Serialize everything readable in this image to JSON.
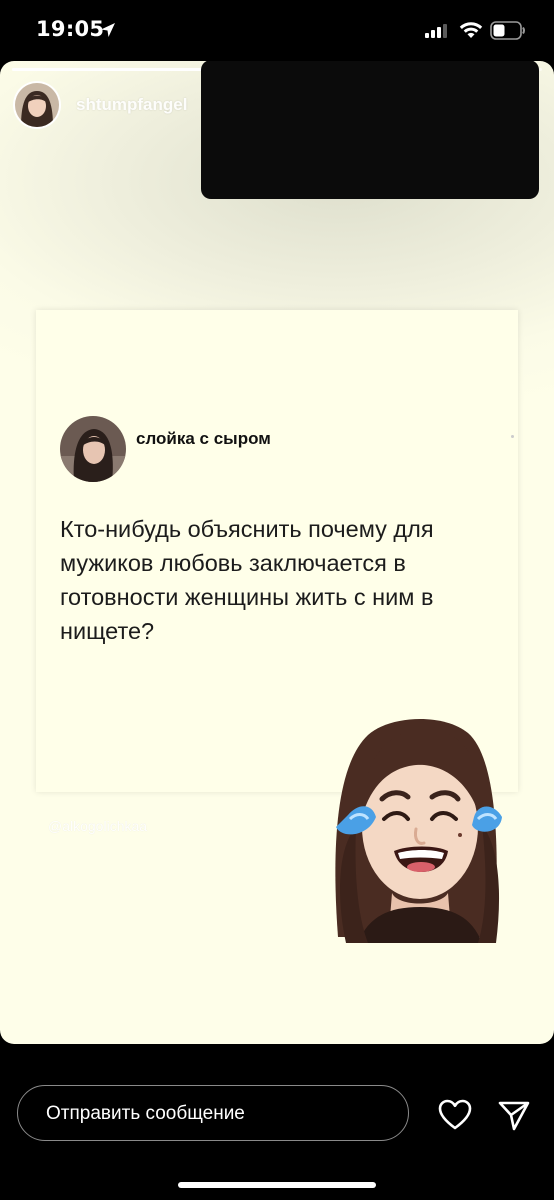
{
  "status_bar": {
    "time": "19:05",
    "icons": [
      "location-arrow-icon",
      "cellular-signal-icon",
      "wifi-icon",
      "battery-icon"
    ]
  },
  "story": {
    "author_name": "shtumpfangel",
    "progress": 0.37,
    "post": {
      "username": "слойка с сыром",
      "text": "Кто-нибудь объяснить почему для мужиков любовь заключается в готовности женщины жить с ним в нищете?"
    },
    "watermark": "@alkogolichkaa",
    "sticker": "crying-laughing-memoji"
  },
  "reply_bar": {
    "placeholder": "Отправить сообщение",
    "like_icon": "heart-icon",
    "send_icon": "send-icon"
  },
  "colors": {
    "story_background": "#fefee9",
    "card_background": "#ffffe9",
    "bar_background": "#000000"
  }
}
